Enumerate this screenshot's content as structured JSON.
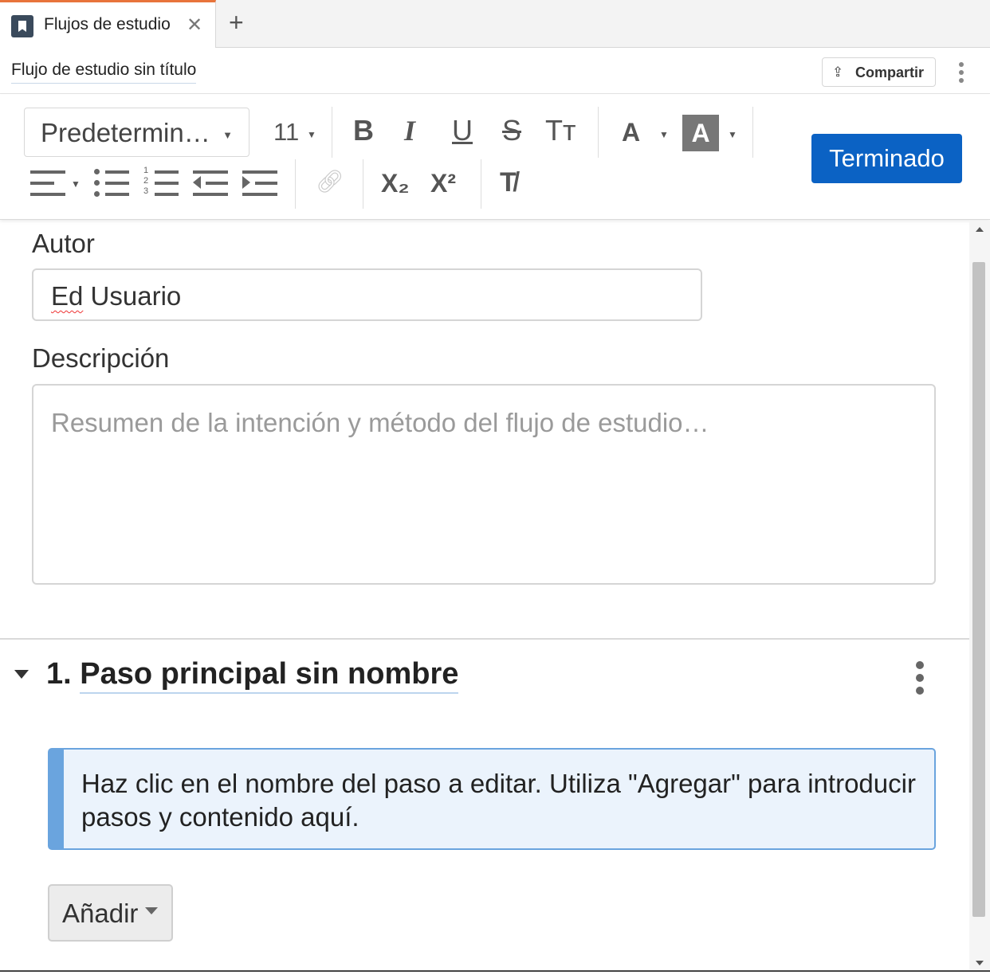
{
  "tabs": [
    {
      "label": "Flujos de estudio",
      "icon": "flow-document-icon",
      "active": true
    }
  ],
  "tab_close_icon": "close-icon",
  "tab_add_icon": "plus-icon",
  "document": {
    "title": "Flujo de estudio sin título",
    "share_label": "Compartir"
  },
  "toolbar": {
    "font_family": "Predetermin…",
    "font_size": "11",
    "bold": "B",
    "italic": "I",
    "underline": "U",
    "strikethrough": "S",
    "text_size": "Tт",
    "font_color": "A",
    "highlight": "A",
    "subscript": "X₂",
    "superscript": "X²",
    "done_label": "Terminado"
  },
  "form": {
    "author_label": "Autor",
    "author_value_first": "Ed",
    "author_value_rest": " Usuario",
    "description_label": "Descripción",
    "description_placeholder": "Resumen de la intención y método del flujo de estudio…"
  },
  "step": {
    "number": "1.",
    "name": "Paso principal sin nombre",
    "info": "Haz clic en el nombre del paso a editar. Utiliza \"Agregar\" para introducir pasos y contenido aquí.",
    "add_label": "Añadir"
  },
  "colors": {
    "accent": "#0b62c4",
    "tab_highlight": "#e8743b",
    "info_border": "#6aa4de",
    "info_bg": "#ebf3fc"
  }
}
